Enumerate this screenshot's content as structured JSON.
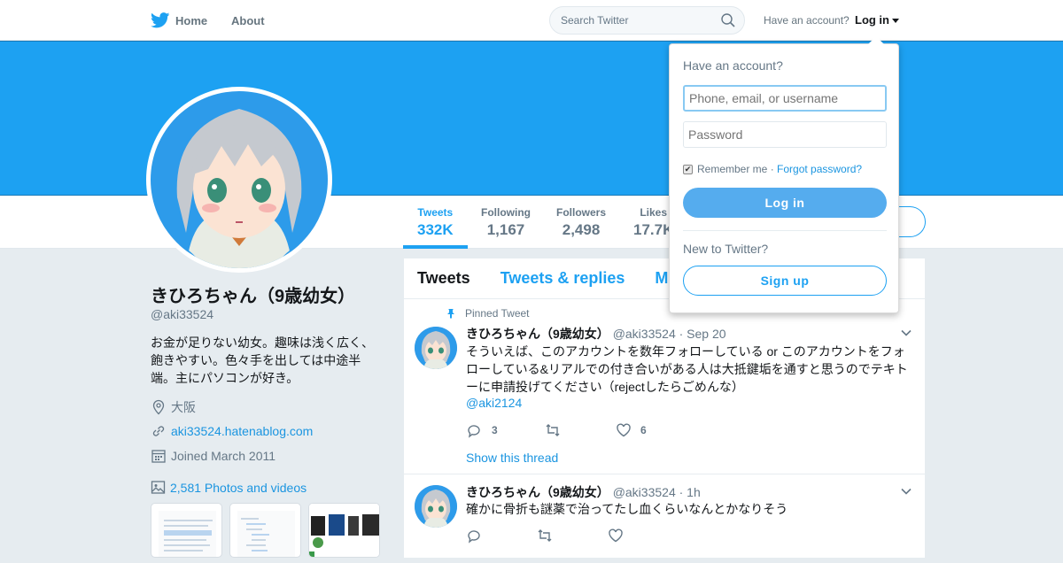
{
  "topbar": {
    "home_label": "Home",
    "about_label": "About",
    "search_placeholder": "Search Twitter",
    "have_account": "Have an account?",
    "login_label": "Log in"
  },
  "stats": [
    {
      "label": "Tweets",
      "value": "332K"
    },
    {
      "label": "Following",
      "value": "1,167"
    },
    {
      "label": "Followers",
      "value": "2,498"
    },
    {
      "label": "Likes",
      "value": "17.7K"
    }
  ],
  "profile": {
    "name": "きひろちゃん（9歳幼女）",
    "handle": "@aki33524",
    "bio": "お金が足りない幼女。趣味は浅く広く、飽きやすい。色々手を出しては中途半端。主にパソコンが好き。",
    "location": "大阪",
    "website": "aki33524.hatenablog.com",
    "joined": "Joined March 2011",
    "photos": "2,581 Photos and videos"
  },
  "timeline": {
    "tabs": [
      "Tweets",
      "Tweets & replies",
      "M"
    ],
    "tweets": [
      {
        "pinned_label": "Pinned Tweet",
        "name": "きひろちゃん（9歳幼女）",
        "handle": "@aki33524",
        "time": "· Sep 20",
        "text": "そういえば、このアカウントを数年フォローしている or このアカウントをフォローしている&リアルでの付き合いがある人は大抵鍵垢を通すと思うのでテキトーに申請投げてください（rejectしたらごめんな）",
        "mention": "@aki2124",
        "replies": "3",
        "likes": "6",
        "thread_link": "Show this thread"
      },
      {
        "name": "きひろちゃん（9歳幼女）",
        "handle": "@aki33524",
        "time": "· 1h",
        "text": "確かに骨折も謎薬で治ってたし血くらいなんとかなりそう"
      }
    ]
  },
  "login_dropdown": {
    "title": "Have an account?",
    "username_placeholder": "Phone, email, or username",
    "password_placeholder": "Password",
    "remember": "Remember me",
    "separator": " · ",
    "forgot": "Forgot password?",
    "login_button": "Log in",
    "new_label": "New to Twitter?",
    "signup_button": "Sign up"
  },
  "colors": {
    "accent": "#1da1f2",
    "banner": "#1da1f2",
    "background": "#e6ecf0"
  }
}
